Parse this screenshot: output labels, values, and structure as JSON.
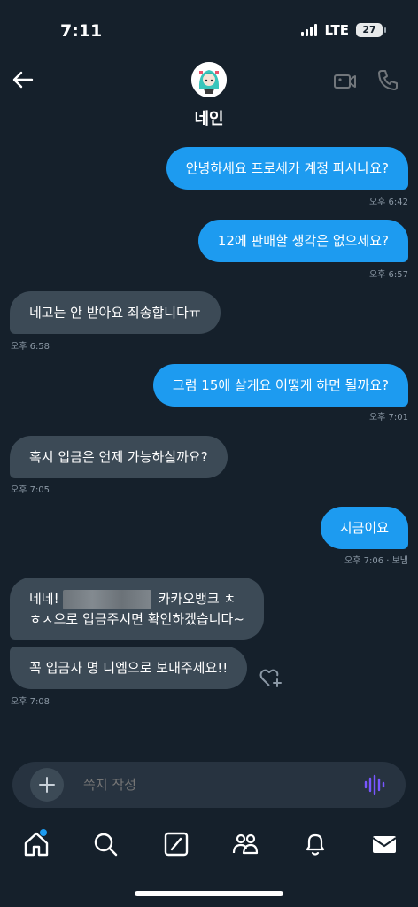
{
  "status": {
    "time": "7:11",
    "network": "LTE",
    "battery": "27"
  },
  "header": {
    "name": "네인",
    "back_icon": "arrow-left-icon",
    "video_icon": "video-icon",
    "call_icon": "phone-icon"
  },
  "messages": [
    {
      "dir": "out",
      "text": "안녕하세요 프로세카 계정 파시나요?",
      "time": "오후 6:42"
    },
    {
      "dir": "out",
      "text": "12에 판매할 생각은 없으세요?",
      "time": "오후 6:57"
    },
    {
      "dir": "in",
      "text": "네고는 안 받아요 죄송합니다ㅠ",
      "time": "오후 6:58"
    },
    {
      "dir": "out",
      "text": "그럼 15에 살게요 어떻게 하면 될까요?",
      "time": "오후 7:01"
    },
    {
      "dir": "in",
      "text": "혹시 입금은 언제 가능하실까요?",
      "time": "오후 7:05"
    },
    {
      "dir": "out",
      "text": "지금이요",
      "time": "오후 7:06 · 보냄"
    },
    {
      "dir": "in",
      "text_a": "네네!",
      "text_b": "카카오뱅크 ㅊ",
      "text_c": "ㅎㅈ으로 입금주시면 확인하겠습니다~"
    },
    {
      "dir": "in",
      "text": "꼭 입금자 명 디엠으로 보내주세요!!",
      "time": "오후 7:08"
    }
  ],
  "composer": {
    "placeholder": "쪽지 작성"
  },
  "tabs": [
    "home",
    "search",
    "grok",
    "communities",
    "notifications",
    "messages"
  ],
  "colors": {
    "background": "#15202b",
    "outgoing": "#1d9bf0",
    "incoming": "#3c4a56",
    "voice": "#7856ff"
  }
}
